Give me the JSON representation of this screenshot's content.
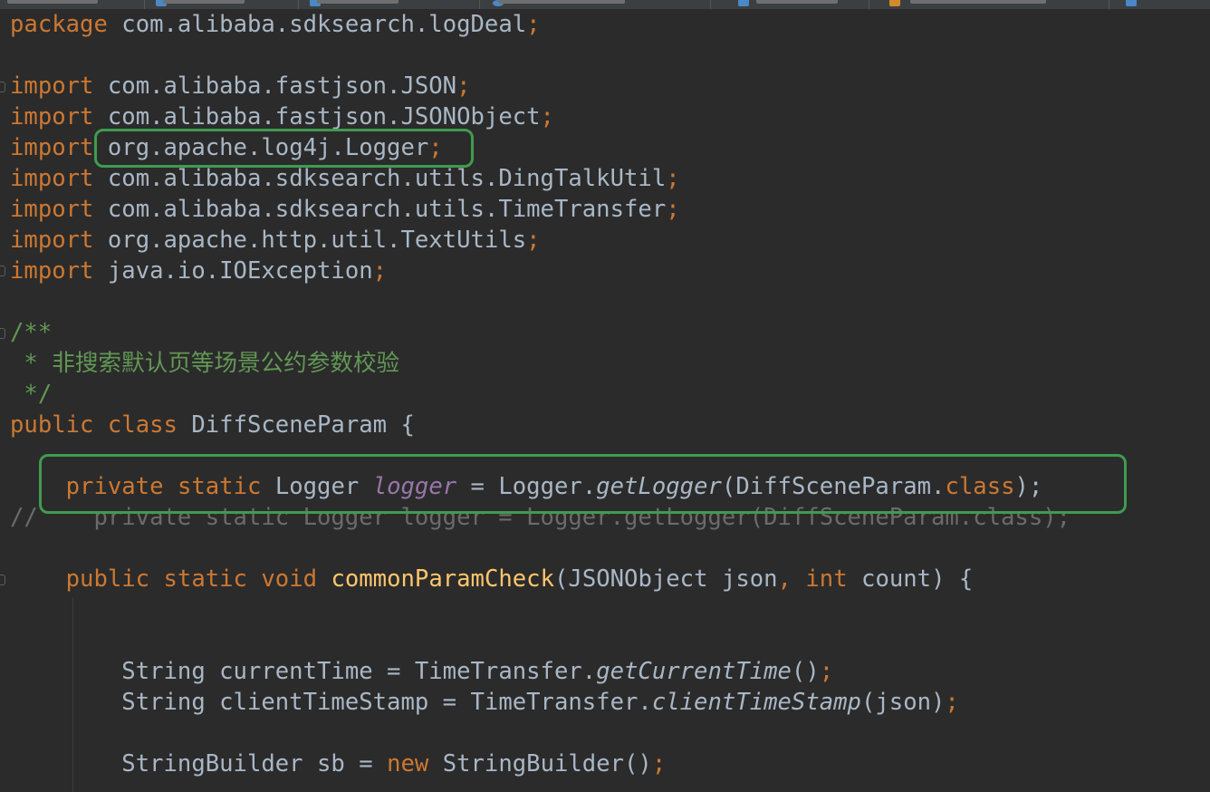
{
  "editor": {
    "package_kw": "package",
    "package_name": "com.alibaba.sdksearch.logDeal",
    "import_kw": "import",
    "imports": [
      "com.alibaba.fastjson.JSON",
      "com.alibaba.fastjson.JSONObject",
      "org.apache.log4j.Logger",
      "com.alibaba.sdksearch.utils.DingTalkUtil",
      "com.alibaba.sdksearch.utils.TimeTransfer",
      "org.apache.http.util.TextUtils",
      "java.io.IOException"
    ],
    "semicolon": ";",
    "doc_open": "/**",
    "doc_star": " * ",
    "doc_text": "非搜索默认页等场景公约参数校验",
    "doc_close": " */",
    "class_decl": {
      "kw1": "public",
      "kw2": "class",
      "name": "DiffSceneParam {"
    },
    "logger_line": {
      "kw1": "private",
      "kw2": "static",
      "type": "Logger",
      "field": "logger",
      "eq": " = Logger.",
      "call": "getLogger",
      "arg": "(DiffSceneParam.",
      "cls": "class",
      "close": ");"
    },
    "commented_line": "//    private static Logger logger = Logger.getLogger(DiffSceneParam.class);",
    "method_decl": {
      "kw1": "public",
      "kw2": "static",
      "kw3": "void",
      "name": "commonParamCheck",
      "params1": "(JSONObject json",
      "comma": ",",
      "kw4": "int",
      "params2": "count) {"
    },
    "body": {
      "l1a": "String currentTime = TimeTransfer.",
      "l1b": "getCurrentTime",
      "l1c": "()",
      "l2a": "String clientTimeStamp = TimeTransfer.",
      "l2b": "clientTimeStamp",
      "l2c": "(json)",
      "l3a": "StringBuilder sb = ",
      "l3kw": "new",
      "l3b": " StringBuilder()"
    }
  }
}
